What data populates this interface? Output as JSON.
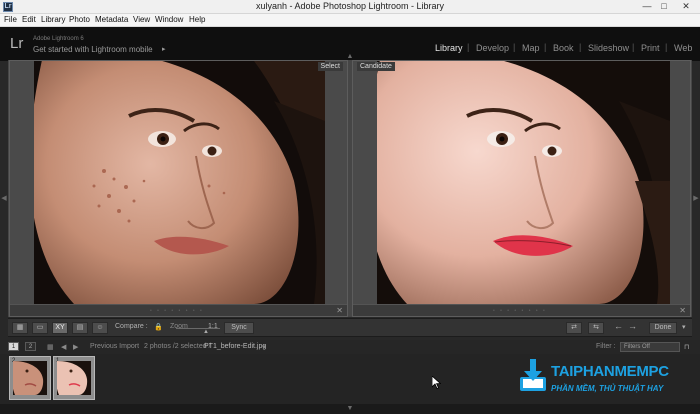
{
  "window": {
    "title": "xulyanh - Adobe Photoshop Lightroom - Library",
    "app_icon": "Lr",
    "min": "—",
    "max": "□",
    "close": "✕"
  },
  "menu": [
    "File",
    "Edit",
    "Library",
    "Photo",
    "Metadata",
    "View",
    "Window",
    "Help"
  ],
  "identity": {
    "logo": "Lr",
    "app_name": "Adobe Lightroom 6",
    "mobile_text": "Get started with Lightroom mobile",
    "mobile_arrow": "▸"
  },
  "modules": {
    "items": [
      "Library",
      "Develop",
      "Map",
      "Book",
      "Slideshow",
      "Print",
      "Web"
    ],
    "active": "Library",
    "separator": "|"
  },
  "compare": {
    "select_label": "Select",
    "candidate_label": "Candidate",
    "close_glyph": "✕",
    "dots": "• • • • • • • •"
  },
  "toolbar": {
    "compare_label": "Compare :",
    "zoom_label": "Zoom",
    "zoom_value": "1:1",
    "sync_label": "Sync",
    "done_label": "Done",
    "xy_label": "XY"
  },
  "filmstrip_bar": {
    "monitor_1": "1",
    "monitor_2": "2",
    "source": "Previous Import",
    "count": "2 photos /2 selected /",
    "filename": "PT1_before-Edit.jpg",
    "filename_arrow": "▾",
    "filter_label": "Filter :",
    "filter_value": "Filters Off"
  },
  "filmstrip": {
    "thumb1_num": "2",
    "thumb2_num": "1"
  },
  "watermark": {
    "title": "TAIPHANMEMPC",
    "subtitle": "PHẦN MỀM, THỦ THUẬT HAY"
  }
}
